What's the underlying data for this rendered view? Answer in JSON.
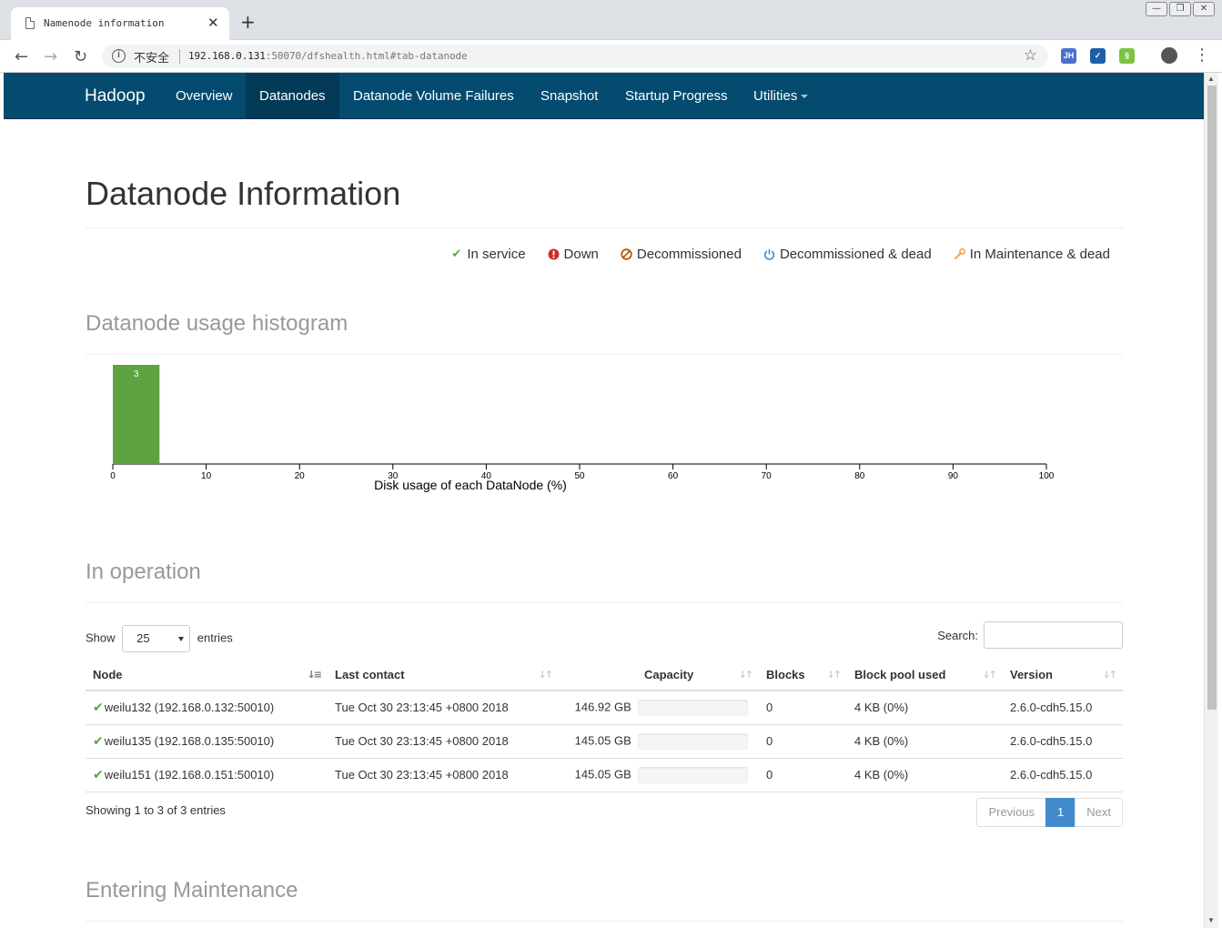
{
  "browser": {
    "tab_title": "Namenode information",
    "tab_close": "✕",
    "new_tab": "+",
    "security_label": "不安全",
    "url_host": "192.168.0.131",
    "url_rest": ":50070/dfshealth.html#tab-datanode",
    "ext1": "JH",
    "ext2": "✓",
    "ext3": "§"
  },
  "navbar": {
    "brand": "Hadoop",
    "items": [
      {
        "label": "Overview"
      },
      {
        "label": "Datanodes"
      },
      {
        "label": "Datanode Volume Failures"
      },
      {
        "label": "Snapshot"
      },
      {
        "label": "Startup Progress"
      },
      {
        "label": "Utilities"
      }
    ]
  },
  "page": {
    "title": "Datanode Information",
    "legend": [
      {
        "label": "In service",
        "icon": "check-icon",
        "color": "#5fa341"
      },
      {
        "label": "Down",
        "icon": "exclamation-circle-icon",
        "color": "#c9302c"
      },
      {
        "label": "Decommissioned",
        "icon": "ban-icon",
        "color": "#b55a0a"
      },
      {
        "label": "Decommissioned & dead",
        "icon": "power-icon",
        "color": "#428bca"
      },
      {
        "label": "In Maintenance & dead",
        "icon": "wrench-icon",
        "color": "#f0ad4e"
      }
    ],
    "histogram_heading": "Datanode usage histogram",
    "operation_heading": "In operation",
    "maintenance_heading": "Entering Maintenance"
  },
  "chart_data": {
    "type": "bar",
    "xlabel": "Disk usage of each DataNode (%)",
    "xlim": [
      0,
      100
    ],
    "xticks": [
      0,
      10,
      20,
      30,
      40,
      50,
      60,
      70,
      80,
      90,
      100
    ],
    "bins": [
      {
        "x0": 0,
        "x1": 5,
        "count": 3
      }
    ],
    "bar_color": "#5fa341"
  },
  "table": {
    "show_label": "Show",
    "entries_value": "25",
    "entries_label": "entries",
    "search_label": "Search:",
    "columns": [
      "Node",
      "Last contact",
      "Capacity",
      "Blocks",
      "Block pool used",
      "Version"
    ],
    "rows": [
      {
        "node": "weilu132 (192.168.0.132:50010)",
        "last_contact": "Tue Oct 30 23:13:45 +0800 2018",
        "capacity": "146.92 GB",
        "usage_fraction": 0,
        "blocks": "0",
        "block_pool_used": "4 KB (0%)",
        "version": "2.6.0-cdh5.15.0"
      },
      {
        "node": "weilu135 (192.168.0.135:50010)",
        "last_contact": "Tue Oct 30 23:13:45 +0800 2018",
        "capacity": "145.05 GB",
        "usage_fraction": 0,
        "blocks": "0",
        "block_pool_used": "4 KB (0%)",
        "version": "2.6.0-cdh5.15.0"
      },
      {
        "node": "weilu151 (192.168.0.151:50010)",
        "last_contact": "Tue Oct 30 23:13:45 +0800 2018",
        "capacity": "145.05 GB",
        "usage_fraction": 0,
        "blocks": "0",
        "block_pool_used": "4 KB (0%)",
        "version": "2.6.0-cdh5.15.0"
      }
    ],
    "info": "Showing 1 to 3 of 3 entries",
    "pager": {
      "previous": "Previous",
      "current": "1",
      "next": "Next"
    }
  }
}
